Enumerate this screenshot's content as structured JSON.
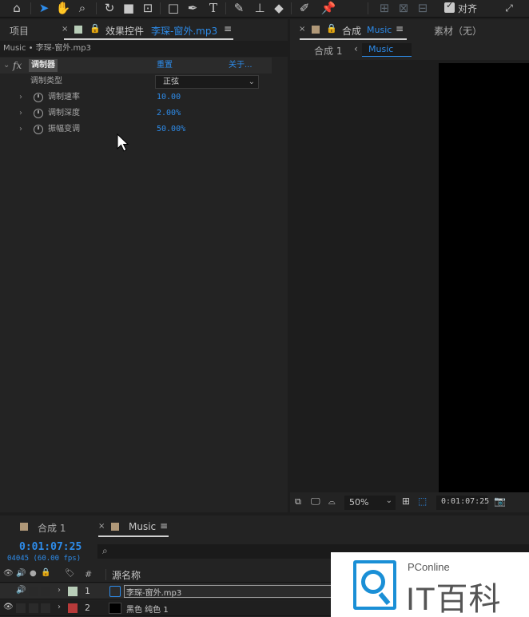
{
  "toolbar": {
    "tools": [
      "home-icon",
      "selection-icon",
      "hand-icon",
      "zoom-icon",
      "rotate-icon",
      "camera-icon",
      "pan-behind-icon",
      "rectangle-icon",
      "pen-icon",
      "type-icon",
      "brush-icon",
      "clone-stamp-icon",
      "eraser-icon",
      "roto-brush-icon",
      "puppet-pin-icon"
    ],
    "snap_label": "对齐",
    "type_glyph": "T"
  },
  "project_tab": "项目",
  "effect_panel": {
    "tab_title": "效果控件",
    "tab_file": "李琛-窗外.mp3",
    "breadcrumb": "Music • 李琛-窗外.mp3",
    "effect_name": "调制器",
    "reset_label": "重置",
    "about_label": "关于...",
    "fx_label": "fx",
    "properties": [
      {
        "label": "调制类型",
        "value": "正弦",
        "dropdown": true
      },
      {
        "label": "调制速率",
        "value": "10.00"
      },
      {
        "label": "调制深度",
        "value": "2.00%"
      },
      {
        "label": "振幅变调",
        "value": "50.00%"
      }
    ]
  },
  "comp_panel": {
    "tab_label": "合成",
    "tab_comp": "Music",
    "footage_tab": "素材（无）",
    "breadcrumb_parent": "合成 1",
    "breadcrumb_current": "Music",
    "zoom": "50%",
    "timecode": "0:01:07:25"
  },
  "timeline": {
    "tabs": [
      "合成 1",
      "Music"
    ],
    "current_time": "0:01:07:25",
    "frame_info": "04045 (60.00 fps)",
    "search_glyph": "⌕",
    "column_hash": "#",
    "column_source": "源名称",
    "layers": [
      {
        "num": "1",
        "name": "李琛-窗外.mp3",
        "color": "#b8cdb8"
      },
      {
        "num": "2",
        "name": "黑色 纯色 1",
        "color": "#b83a3a"
      }
    ]
  },
  "watermark": {
    "brand_top": "PConline",
    "brand_main": "IT百科"
  }
}
